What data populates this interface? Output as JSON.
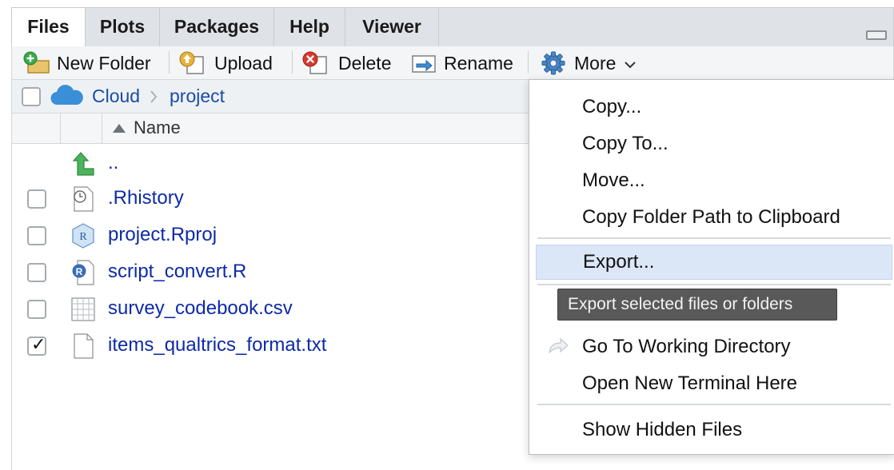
{
  "tabs": [
    {
      "label": "Files",
      "active": true
    },
    {
      "label": "Plots",
      "active": false
    },
    {
      "label": "Packages",
      "active": false
    },
    {
      "label": "Help",
      "active": false
    },
    {
      "label": "Viewer",
      "active": false
    }
  ],
  "toolbar": {
    "new_folder": {
      "label": "New Folder",
      "icon": "new-folder-icon"
    },
    "upload": {
      "label": "Upload",
      "icon": "upload-icon"
    },
    "delete": {
      "label": "Delete",
      "icon": "delete-icon"
    },
    "rename": {
      "label": "Rename",
      "icon": "rename-icon"
    },
    "more": {
      "label": "More",
      "icon": "gear-icon"
    }
  },
  "breadcrumb": {
    "items": [
      "Cloud",
      "project"
    ]
  },
  "table": {
    "name_header": "Name",
    "sort": "ascending"
  },
  "files": [
    {
      "name": "..",
      "icon": "parent-folder-icon",
      "has_checkbox": false,
      "checked": false
    },
    {
      "name": ".Rhistory",
      "icon": "history-file-icon",
      "has_checkbox": true,
      "checked": false
    },
    {
      "name": "project.Rproj",
      "icon": "rproj-file-icon",
      "has_checkbox": true,
      "checked": false
    },
    {
      "name": "script_convert.R",
      "icon": "r-script-icon",
      "has_checkbox": true,
      "checked": false
    },
    {
      "name": "survey_codebook.csv",
      "icon": "csv-file-icon",
      "has_checkbox": true,
      "checked": false
    },
    {
      "name": "items_qualtrics_format.txt",
      "icon": "text-file-icon",
      "has_checkbox": true,
      "checked": true
    }
  ],
  "menu": {
    "copy": "Copy...",
    "copy_to": "Copy To...",
    "move": "Move...",
    "copy_path": "Copy Folder Path to Clipboard",
    "export": "Export...",
    "go_to_wd": "Go To Working Directory",
    "open_terminal": "Open New Terminal Here",
    "show_hidden": "Show Hidden Files",
    "highlighted": "Export..."
  },
  "tooltip": "Export selected files or folders",
  "colors": {
    "link": "#0d2aa8",
    "highlight": "#dbe6f6",
    "tooltip_bg": "#595959"
  }
}
